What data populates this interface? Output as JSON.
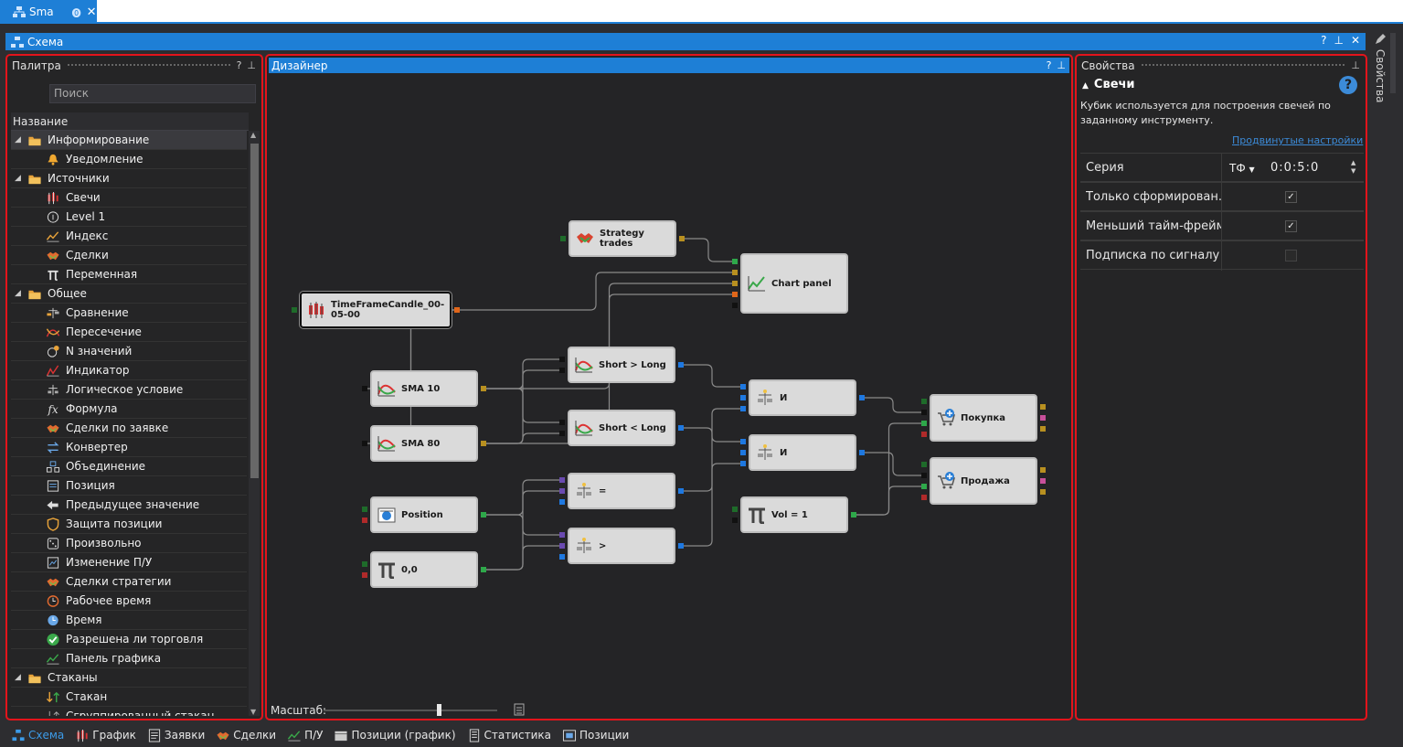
{
  "document_tab": {
    "label": "Sma"
  },
  "window": {
    "title": "Схема"
  },
  "side_tab": {
    "label": "Свойства"
  },
  "palette": {
    "title": "Палитра",
    "search_placeholder": "Поиск",
    "column_header": "Название",
    "rows": [
      {
        "kind": "cat",
        "label": "Информирование",
        "icon": "folder-icon"
      },
      {
        "kind": "item",
        "label": "Уведомление",
        "icon": "bell-icon"
      },
      {
        "kind": "cat",
        "label": "Источники",
        "icon": "folder-icon"
      },
      {
        "kind": "item",
        "label": "Свечи",
        "icon": "candles-icon"
      },
      {
        "kind": "item",
        "label": "Level 1",
        "icon": "level1-icon"
      },
      {
        "kind": "item",
        "label": "Индекс",
        "icon": "index-icon"
      },
      {
        "kind": "item",
        "label": "Сделки",
        "icon": "handshake-icon"
      },
      {
        "kind": "item",
        "label": "Переменная",
        "icon": "pi-icon"
      },
      {
        "kind": "cat",
        "label": "Общее",
        "icon": "folder-icon"
      },
      {
        "kind": "item",
        "label": "Сравнение",
        "icon": "scales-icon"
      },
      {
        "kind": "item",
        "label": "Пересечение",
        "icon": "crossing-icon"
      },
      {
        "kind": "item",
        "label": "N значений",
        "icon": "n-values-icon"
      },
      {
        "kind": "item",
        "label": "Индикатор",
        "icon": "indicator-icon"
      },
      {
        "kind": "item",
        "label": "Логическое условие",
        "icon": "logic-icon"
      },
      {
        "kind": "item",
        "label": "Формула",
        "icon": "formula-icon"
      },
      {
        "kind": "item",
        "label": "Сделки по заявке",
        "icon": "handshake-icon"
      },
      {
        "kind": "item",
        "label": "Конвертер",
        "icon": "converter-icon"
      },
      {
        "kind": "item",
        "label": "Объединение",
        "icon": "union-icon"
      },
      {
        "kind": "item",
        "label": "Позиция",
        "icon": "position-icon"
      },
      {
        "kind": "item",
        "label": "Предыдущее значение",
        "icon": "back-arrow-icon"
      },
      {
        "kind": "item",
        "label": "Защита позиции",
        "icon": "shield-icon"
      },
      {
        "kind": "item",
        "label": "Произвольно",
        "icon": "dice-icon"
      },
      {
        "kind": "item",
        "label": "Изменение П/У",
        "icon": "pnl-icon"
      },
      {
        "kind": "item",
        "label": "Сделки стратегии",
        "icon": "handshake-icon"
      },
      {
        "kind": "item",
        "label": "Рабочее время",
        "icon": "clock-icon"
      },
      {
        "kind": "item",
        "label": "Время",
        "icon": "time-icon"
      },
      {
        "kind": "item",
        "label": "Разрешена ли торговля",
        "icon": "check-circle-icon"
      },
      {
        "kind": "item",
        "label": "Панель графика",
        "icon": "chart-icon"
      },
      {
        "kind": "cat",
        "label": "Стаканы",
        "icon": "folder-icon"
      },
      {
        "kind": "item",
        "label": "Стакан",
        "icon": "orderbook-icon"
      },
      {
        "kind": "item",
        "label": "Сгруппированный стакан",
        "icon": "grouped-orderbook-icon"
      }
    ]
  },
  "designer": {
    "title": "Дизайнер",
    "zoom_label": "Масштаб:",
    "zoom_value": 0.65,
    "nodes": {
      "strategy_trades": "Strategy trades",
      "chart_panel": "Chart panel",
      "candles": "TimeFrameCandle_00-05-00",
      "sma10": "SMA 10",
      "sma80": "SMA 80",
      "cross1": "Short > Long",
      "cross2": "Short < Long",
      "and1": "И",
      "and2": "И",
      "buy": "Покупка",
      "sell": "Продажа",
      "position": "Position",
      "zero": "0,0",
      "eq": "=",
      "gt": ">",
      "vol": "Vol = 1"
    }
  },
  "properties": {
    "title": "Свойства",
    "section": "Свечи",
    "description": "Кубик используется для построения свечей по заданному инструменту.",
    "advanced_link": "Продвинутые настройки",
    "rows": {
      "series": {
        "name": "Серия",
        "mode": "ТФ",
        "value": "0:0:5:0"
      },
      "only_formed": {
        "name": "Только сформирован...",
        "checked": true
      },
      "lower_tf": {
        "name": "Меньший тайм-фрейм",
        "checked": true
      },
      "signal_sub": {
        "name": "Подписка по сигналу",
        "checked": false
      }
    }
  },
  "bottom_tabs": [
    "Схема",
    "График",
    "Заявки",
    "Сделки",
    "П/У",
    "Позиции (график)",
    "Статистика",
    "Позиции"
  ],
  "colors": {
    "accent": "#1e7fd6",
    "highlight": "#e3141b"
  }
}
